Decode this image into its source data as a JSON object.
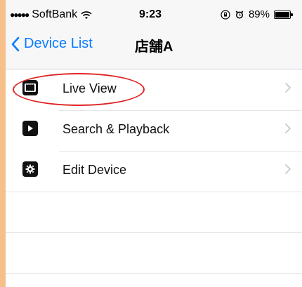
{
  "status_bar": {
    "signal": "●●●●●",
    "carrier": "SoftBank",
    "time": "9:23",
    "battery": "89%"
  },
  "nav": {
    "back_label": "Device List",
    "title": "店舗A"
  },
  "menu": {
    "items": [
      {
        "label": "Live View",
        "icon": "film-strip-icon"
      },
      {
        "label": "Search & Playback",
        "icon": "play-icon"
      },
      {
        "label": "Edit Device",
        "icon": "gear-icon"
      }
    ]
  },
  "colors": {
    "accent": "#0a7cff",
    "annotation": "#e02424",
    "background": "#f7c08a"
  }
}
